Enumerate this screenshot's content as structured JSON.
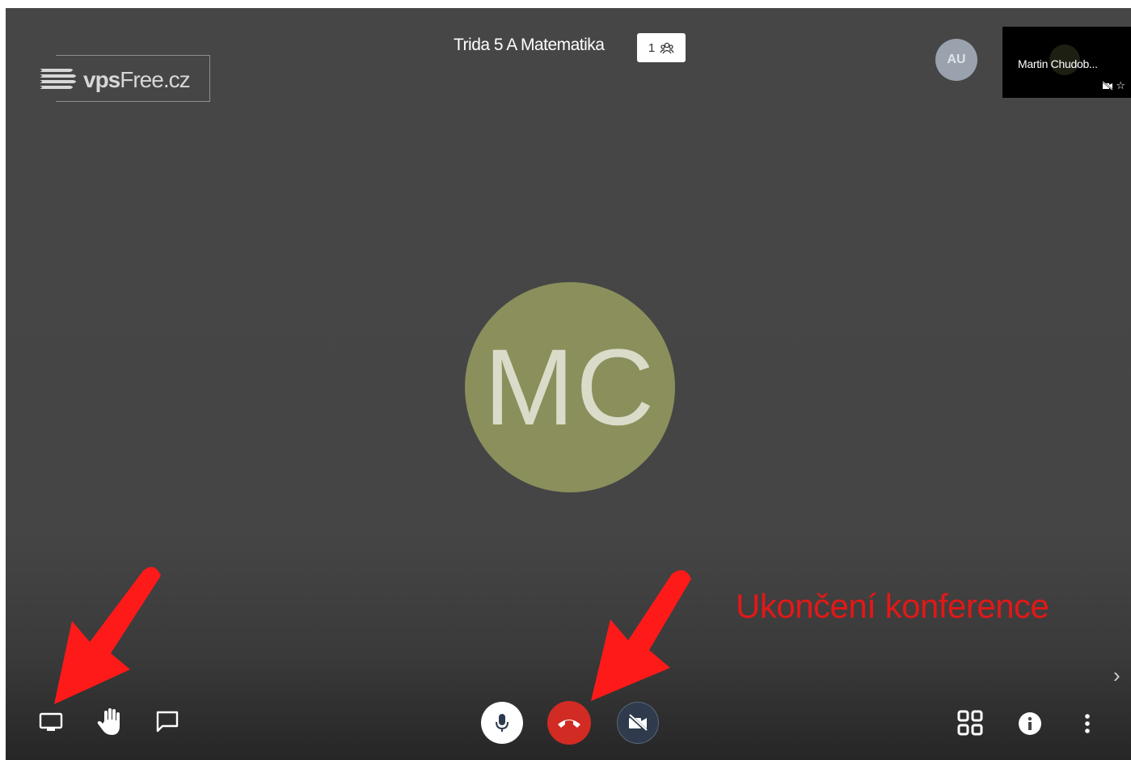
{
  "logo": {
    "brand_bold": "vps",
    "brand_light": "Free.cz"
  },
  "conference": {
    "title": "Trida 5 A Matematika",
    "participant_count": "1"
  },
  "participants": {
    "local_initials": "AU",
    "remote": {
      "name": "Martin Chudob...",
      "initials": "MC"
    }
  },
  "annotation": {
    "text": "Ukončení  konference"
  },
  "toolbar": {
    "left": [
      "share-screen",
      "raise-hand",
      "chat"
    ],
    "center": [
      "microphone",
      "hang-up",
      "camera-off"
    ],
    "right": [
      "tile-view",
      "info",
      "more"
    ]
  },
  "colors": {
    "background": "#454545",
    "hangup": "#d12b23",
    "avatar_mc": "#8a8f5c",
    "annotation": "#e21818"
  }
}
